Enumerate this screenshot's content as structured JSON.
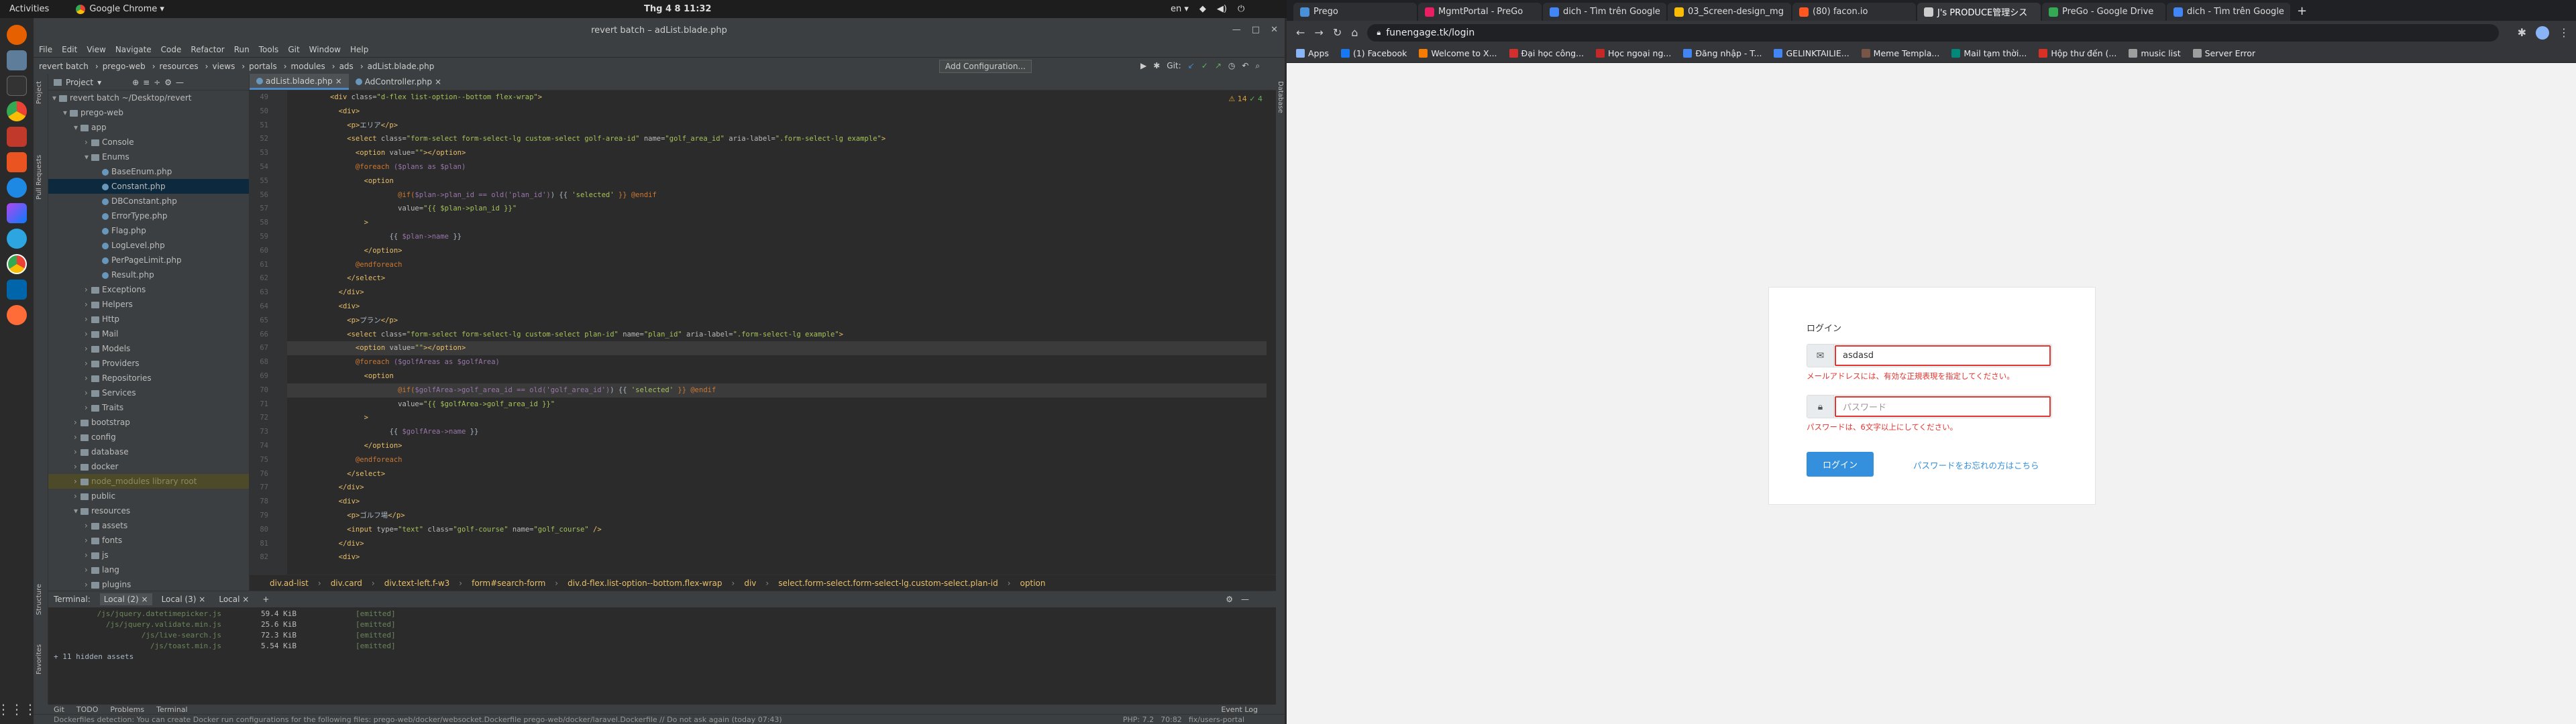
{
  "system": {
    "activities": "Activities",
    "app_name": "Google Chrome ▾",
    "clock": "Thg 4 8  11:32",
    "lang": "en ▾"
  },
  "ide": {
    "title": "revert batch – adList.blade.php",
    "menu": [
      "File",
      "Edit",
      "View",
      "Navigate",
      "Code",
      "Refactor",
      "Run",
      "Tools",
      "Git",
      "Window",
      "Help"
    ],
    "breadcrumb": [
      "revert batch",
      "prego-web",
      "resources",
      "views",
      "portals",
      "modules",
      "ads",
      "adList.blade.php"
    ],
    "add_config": "Add Configuration...",
    "git_label": "Git:",
    "project_label": "Project",
    "tree": [
      {
        "label": "revert batch  ~/Desktop/revert",
        "indent": 0,
        "type": "folder",
        "open": true
      },
      {
        "label": "prego-web",
        "indent": 1,
        "type": "folder",
        "open": true
      },
      {
        "label": "app",
        "indent": 2,
        "type": "folder",
        "open": true
      },
      {
        "label": "Console",
        "indent": 3,
        "type": "folder",
        "open": false
      },
      {
        "label": "Enums",
        "indent": 3,
        "type": "folder",
        "open": true
      },
      {
        "label": "BaseEnum.php",
        "indent": 4,
        "type": "php"
      },
      {
        "label": "Constant.php",
        "indent": 4,
        "type": "php",
        "selected": true
      },
      {
        "label": "DBConstant.php",
        "indent": 4,
        "type": "php"
      },
      {
        "label": "ErrorType.php",
        "indent": 4,
        "type": "php"
      },
      {
        "label": "Flag.php",
        "indent": 4,
        "type": "php"
      },
      {
        "label": "LogLevel.php",
        "indent": 4,
        "type": "php"
      },
      {
        "label": "PerPageLimit.php",
        "indent": 4,
        "type": "php"
      },
      {
        "label": "Result.php",
        "indent": 4,
        "type": "php"
      },
      {
        "label": "Exceptions",
        "indent": 3,
        "type": "folder",
        "open": false
      },
      {
        "label": "Helpers",
        "indent": 3,
        "type": "folder",
        "open": false
      },
      {
        "label": "Http",
        "indent": 3,
        "type": "folder",
        "open": false
      },
      {
        "label": "Mail",
        "indent": 3,
        "type": "folder",
        "open": false
      },
      {
        "label": "Models",
        "indent": 3,
        "type": "folder",
        "open": false
      },
      {
        "label": "Providers",
        "indent": 3,
        "type": "folder",
        "open": false
      },
      {
        "label": "Repositories",
        "indent": 3,
        "type": "folder",
        "open": false
      },
      {
        "label": "Services",
        "indent": 3,
        "type": "folder",
        "open": false
      },
      {
        "label": "Traits",
        "indent": 3,
        "type": "folder",
        "open": false
      },
      {
        "label": "bootstrap",
        "indent": 2,
        "type": "folder",
        "open": false
      },
      {
        "label": "config",
        "indent": 2,
        "type": "folder",
        "open": false
      },
      {
        "label": "database",
        "indent": 2,
        "type": "folder",
        "open": false
      },
      {
        "label": "docker",
        "indent": 2,
        "type": "folder",
        "open": false
      },
      {
        "label": "node_modules  library root",
        "indent": 2,
        "type": "folder",
        "open": false,
        "excluded": true
      },
      {
        "label": "public",
        "indent": 2,
        "type": "folder",
        "open": false
      },
      {
        "label": "resources",
        "indent": 2,
        "type": "folder",
        "open": true
      },
      {
        "label": "assets",
        "indent": 3,
        "type": "folder",
        "open": false
      },
      {
        "label": "fonts",
        "indent": 3,
        "type": "folder",
        "open": false
      },
      {
        "label": "js",
        "indent": 3,
        "type": "folder",
        "open": false
      },
      {
        "label": "lang",
        "indent": 3,
        "type": "folder",
        "open": false
      },
      {
        "label": "plugins",
        "indent": 3,
        "type": "folder",
        "open": false
      }
    ],
    "tabs": [
      {
        "label": "adList.blade.php",
        "active": true
      },
      {
        "label": "AdController.php",
        "active": false
      }
    ],
    "line_start": 49,
    "code": [
      [
        [
          "<div ",
          "tag"
        ],
        [
          "class=",
          "attr"
        ],
        [
          "\"d-flex list-option--bottom flex-wrap\"",
          "str"
        ],
        [
          ">",
          "tag"
        ]
      ],
      [
        [
          "  <div>",
          "tag"
        ]
      ],
      [
        [
          "    <p>",
          "tag"
        ],
        [
          "エリア",
          "txt"
        ],
        [
          "</p>",
          "tag"
        ]
      ],
      [
        [
          "    <select ",
          "tag"
        ],
        [
          "class=",
          "attr"
        ],
        [
          "\"form-select form-select-lg custom-select golf-area-id\" ",
          "str"
        ],
        [
          "name=",
          "attr"
        ],
        [
          "\"golf_area_id\" ",
          "str"
        ],
        [
          "aria-label=",
          "attr"
        ],
        [
          "\".form-select-lg example\"",
          "str"
        ],
        [
          ">",
          "tag"
        ]
      ],
      [
        [
          "      <option ",
          "tag"
        ],
        [
          "value=",
          "attr"
        ],
        [
          "\"\"",
          "str"
        ],
        [
          "></option>",
          "tag"
        ]
      ],
      [
        [
          "      @foreach ",
          "kw"
        ],
        [
          "($plans as $plan)",
          "var"
        ]
      ],
      [
        [
          "        <option",
          "tag"
        ]
      ],
      [
        [
          "                @if(",
          "kw"
        ],
        [
          "$plan->plan_id == old('plan_id')",
          "var"
        ],
        [
          ") {{ ",
          "txt"
        ],
        [
          "'selected'",
          "str"
        ],
        [
          " }} @endif",
          "kw"
        ]
      ],
      [
        [
          "                value=",
          "attr"
        ],
        [
          "\"{{ $plan->plan_id }}\"",
          "str"
        ]
      ],
      [
        [
          "        >",
          "tag"
        ]
      ],
      [
        [
          "              {{ ",
          "txt"
        ],
        [
          "$plan->name",
          "var"
        ],
        [
          " }}",
          "txt"
        ]
      ],
      [
        [
          "        </option>",
          "tag"
        ]
      ],
      [
        [
          "      @endforeach",
          "kw"
        ]
      ],
      [
        [
          "    </select>",
          "tag"
        ]
      ],
      [
        [
          "  </div>",
          "tag"
        ]
      ],
      [
        [
          "  <div>",
          "tag"
        ]
      ],
      [
        [
          "    <p>",
          "tag"
        ],
        [
          "プラン",
          "txt"
        ],
        [
          "</p>",
          "tag"
        ]
      ],
      [
        [
          "    <select ",
          "tag"
        ],
        [
          "class=",
          "attr"
        ],
        [
          "\"form-select form-select-lg custom-select plan-id\" ",
          "str"
        ],
        [
          "name=",
          "attr"
        ],
        [
          "\"plan_id\" ",
          "str"
        ],
        [
          "aria-label=",
          "attr"
        ],
        [
          "\".form-select-lg example\"",
          "str"
        ],
        [
          ">",
          "tag"
        ]
      ],
      [
        [
          "      <option ",
          "tag"
        ],
        [
          "value=",
          "attr"
        ],
        [
          "\"\"",
          "str"
        ],
        [
          "></option>",
          "tag"
        ]
      ],
      [
        [
          "      @foreach ",
          "kw"
        ],
        [
          "($golfAreas as $golfArea)",
          "var"
        ]
      ],
      [
        [
          "        <option",
          "tag"
        ]
      ],
      [
        [
          "                @if(",
          "kw"
        ],
        [
          "$golfArea->golf_area_id == old('golf_area_id')",
          "var"
        ],
        [
          ") {{ ",
          "txt"
        ],
        [
          "'selected'",
          "str"
        ],
        [
          " }} @endif",
          "kw"
        ]
      ],
      [
        [
          "                value=",
          "attr"
        ],
        [
          "\"{{ $golfArea->golf_area_id }}\"",
          "str"
        ]
      ],
      [
        [
          "        >",
          "tag"
        ]
      ],
      [
        [
          "              {{ ",
          "txt"
        ],
        [
          "$golfArea->name",
          "var"
        ],
        [
          " }}",
          "txt"
        ]
      ],
      [
        [
          "        </option>",
          "tag"
        ]
      ],
      [
        [
          "      @endforeach",
          "kw"
        ]
      ],
      [
        [
          "    </select>",
          "tag"
        ]
      ],
      [
        [
          "  </div>",
          "tag"
        ]
      ],
      [
        [
          "  <div>",
          "tag"
        ]
      ],
      [
        [
          "    <p>",
          "tag"
        ],
        [
          "ゴルフ場",
          "txt"
        ],
        [
          "</p>",
          "tag"
        ]
      ],
      [
        [
          "    <input ",
          "tag"
        ],
        [
          "type=",
          "attr"
        ],
        [
          "\"text\" ",
          "str"
        ],
        [
          "class=",
          "attr"
        ],
        [
          "\"golf-course\" ",
          "str"
        ],
        [
          "name=",
          "attr"
        ],
        [
          "\"golf_course\" ",
          "str"
        ],
        [
          "/>",
          "tag"
        ]
      ],
      [
        [
          "  </div>",
          "tag"
        ]
      ],
      [
        [
          "  <div>",
          "tag"
        ]
      ]
    ],
    "editor_crumbs": [
      "div.ad-list",
      "div.card",
      "div.text-left.f-w3",
      "form#search-form",
      "div.d-flex.list-option--bottom.flex-wrap",
      "div",
      "select.form-select.form-select-lg.custom-select.plan-id",
      "option"
    ],
    "terminal": {
      "label": "Terminal:",
      "tabs": [
        "Local (2)",
        "Local (3)",
        "Local"
      ],
      "rows": [
        {
          "file": "/js/jquery.datetimepicker.js",
          "size": "59.4 KiB",
          "status": "[emitted]"
        },
        {
          "file": "/js/jquery.validate.min.js",
          "size": "25.6 KiB",
          "status": "[emitted]"
        },
        {
          "file": "/js/live-search.js",
          "size": "72.3 KiB",
          "status": "[emitted]"
        },
        {
          "file": "/js/toast.min.js",
          "size": "5.54 KiB",
          "status": "[emitted]"
        }
      ],
      "hidden": "+ 11 hidden assets"
    },
    "bottom_tabs": [
      "Git",
      "TODO",
      "Problems",
      "Terminal"
    ],
    "event_log": "Event Log",
    "status": "Dockerfiles detection: You can create Docker run configurations for the following files: prego-web/docker/websocket.Dockerfile prego-web/docker/laravel.Dockerfile // Do not ask again (today 07:43)",
    "status_right": [
      "PHP: 7.2",
      "70:82",
      "fix/users-portal"
    ],
    "side_labels": {
      "project": "Project",
      "pull": "Pull Requests",
      "structure": "Structure",
      "fav": "Favorites",
      "db": "Database"
    },
    "warn_count": "14",
    "ok_count": "4"
  },
  "browser": {
    "tabs": [
      {
        "label": "Prego",
        "color": "#4a90d9"
      },
      {
        "label": "MgmtPortal - PreGo",
        "color": "#e91e63"
      },
      {
        "label": "dich - Tìm trên Google",
        "color": "#4285f4"
      },
      {
        "label": "03_Screen-design_mg",
        "color": "#fbbc04"
      },
      {
        "label": "(80) facon.io",
        "color": "#ff5722"
      },
      {
        "label": "J's PRODUCE管理シス",
        "color": "#cccccc",
        "active": true
      },
      {
        "label": "PreGo - Google Drive",
        "color": "#34a853"
      },
      {
        "label": "dich - Tìm trên Google",
        "color": "#4285f4"
      }
    ],
    "url": "funengage.tk/login",
    "bookmarks": [
      {
        "label": "Apps",
        "color": "#8ab4f8"
      },
      {
        "label": "(1) Facebook",
        "color": "#1877f2"
      },
      {
        "label": "Welcome to X...",
        "color": "#f57c00"
      },
      {
        "label": "Đại học công...",
        "color": "#d32f2f"
      },
      {
        "label": "Học ngoại ng...",
        "color": "#c62828"
      },
      {
        "label": "Đăng nhập - T...",
        "color": "#4285f4"
      },
      {
        "label": "GELINKTAILIE...",
        "color": "#4285f4"
      },
      {
        "label": "Meme Templa...",
        "color": "#795548"
      },
      {
        "label": "Mail tạm thời...",
        "color": "#00897b"
      },
      {
        "label": "Hộp thư đến (...",
        "color": "#d93025"
      },
      {
        "label": "music list",
        "color": "#9e9e9e"
      },
      {
        "label": "Server Error",
        "color": "#9e9e9e"
      }
    ],
    "login": {
      "title": "ログイン",
      "email_value": "asdasd",
      "email_error": "メールアドレスには、有効な正規表現を指定してください。",
      "password_placeholder": "パスワード",
      "password_error": "パスワードは、6文字以上にしてください。",
      "submit": "ログイン",
      "forgot": "パスワードをお忘れの方はこちら"
    }
  }
}
